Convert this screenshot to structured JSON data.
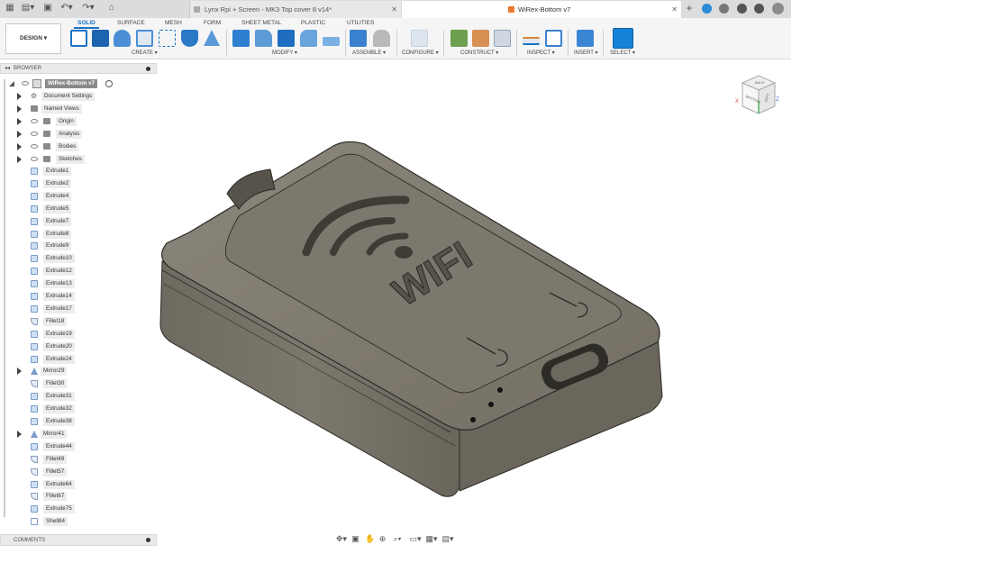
{
  "tabs": {
    "inactive": "Lynx Rpi + Screen - MK3 Top cover 8 v14*",
    "active": "WiRex-Bottom v7"
  },
  "workspace": "DESIGN",
  "ribbon_tabs": [
    "SOLID",
    "SURFACE",
    "MESH",
    "FORM",
    "SHEET METAL",
    "PLASTIC",
    "UTILITIES"
  ],
  "groups": [
    "CREATE",
    "MODIFY",
    "ASSEMBLE",
    "CONFIGURE",
    "CONSTRUCT",
    "INSPECT",
    "INSERT",
    "SELECT"
  ],
  "browser": {
    "title": "BROWSER",
    "root": "WiRex-Bottom v7",
    "folders": [
      "Document Settings",
      "Named Views",
      "Origin",
      "Analysis",
      "Bodies",
      "Sketches"
    ],
    "features": [
      "Extrude1",
      "Extrude2",
      "Extrude4",
      "Extrude5",
      "Extrude7",
      "Extrude8",
      "Extrude9",
      "Extrude10",
      "Extrude12",
      "Extrude13",
      "Extrude14",
      "Extrude17",
      "Fillet18",
      "Extrude19",
      "Extrude20",
      "Extrude24",
      "Mirror29",
      "Fillet30",
      "Extrude31",
      "Extrude32",
      "Extrude38",
      "Mirror41",
      "Extrude44",
      "Fillet49",
      "Fillet57",
      "Extrude64",
      "Fillet67",
      "Extrude75",
      "Shell84"
    ]
  },
  "comments": "COMMENTS",
  "model_text": "WIFI",
  "viewcube": {
    "top": "BACK",
    "front": "BOTTOM",
    "side": "LEFT",
    "x": "X",
    "z": "Z"
  }
}
